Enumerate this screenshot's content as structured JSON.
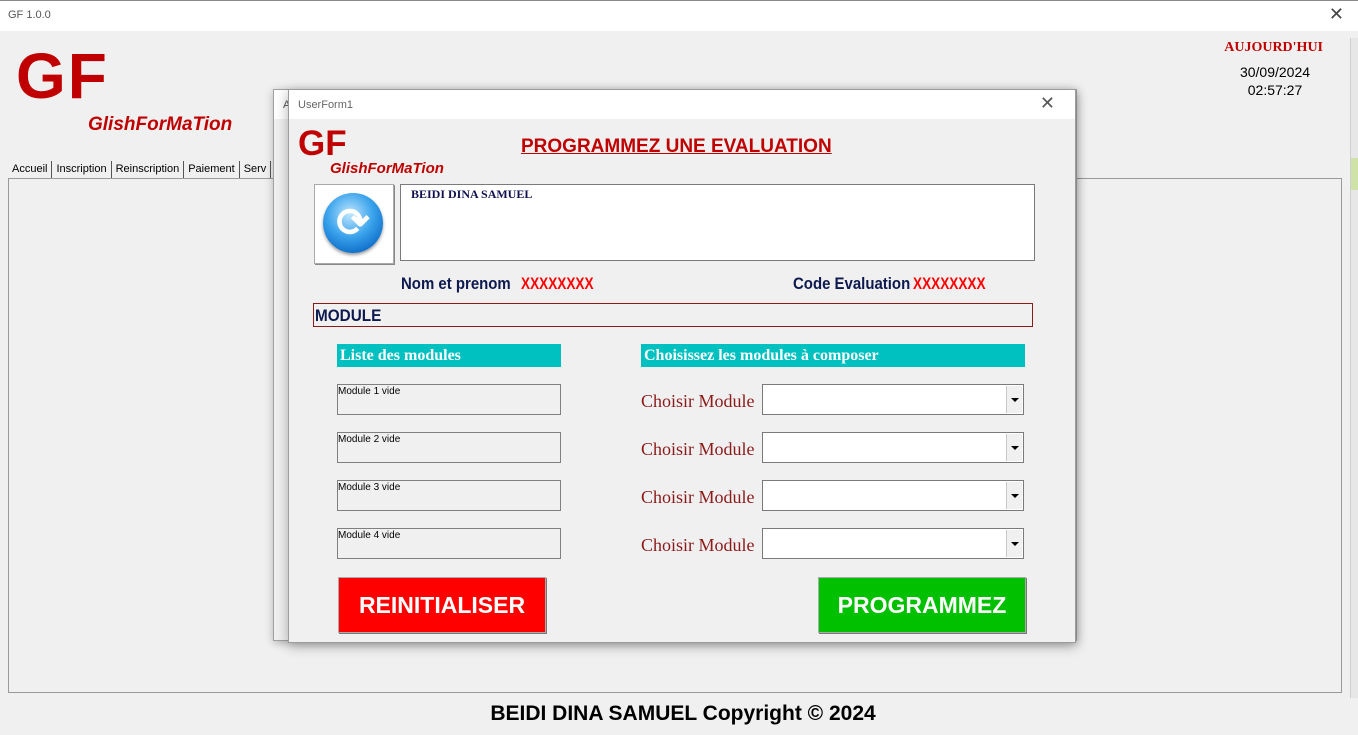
{
  "window": {
    "title": "GF 1.0.0",
    "close_glyph": "✕"
  },
  "brand": {
    "logo": "GF",
    "name": "GlishForMaTion",
    "color": "#c00000"
  },
  "today": {
    "label": "AUJOURD'HUI",
    "date": "30/09/2024",
    "time": "02:57:27"
  },
  "tabs": [
    {
      "label": "Accueil"
    },
    {
      "label": "Inscription"
    },
    {
      "label": "Reinscription"
    },
    {
      "label": "Paiement"
    },
    {
      "label": "Serv"
    }
  ],
  "background_form": {
    "title": "A",
    "close_glyph": "✕"
  },
  "dialog": {
    "title": "UserForm1",
    "close_glyph": "✕",
    "logo": "GF",
    "brand": "GlishForMaTion",
    "heading": "PROGRAMMEZ UNE EVALUATION",
    "photo_icon": "refresh-icon",
    "student_name": "BEIDI DINA SAMUEL",
    "nom_label": "Nom et prenom",
    "nom_value": "XXXXXXXX",
    "code_label": "Code Evaluation",
    "code_value": "XXXXXXXX",
    "module_section": "MODULE",
    "list_header": "Liste des modules",
    "choose_header": "Choisissez les modules à composer",
    "modules": [
      {
        "label": "Module 1 vide"
      },
      {
        "label": "Module 2 vide"
      },
      {
        "label": "Module 3 vide"
      },
      {
        "label": "Module 4 vide"
      }
    ],
    "choose_rows": [
      {
        "label": "Choisir Module",
        "value": ""
      },
      {
        "label": "Choisir Module",
        "value": ""
      },
      {
        "label": "Choisir Module",
        "value": ""
      },
      {
        "label": "Choisir Module",
        "value": ""
      }
    ],
    "reset_button": "REINITIALISER",
    "submit_button": "PROGRAMMEZ",
    "colors": {
      "reset": "#ff0000",
      "submit": "#00c000",
      "header_bg": "#00c0c0",
      "accent": "#c00000",
      "placeholder": "#ff0000"
    }
  },
  "footer": "BEIDI DINA SAMUEL Copyright © 2024"
}
